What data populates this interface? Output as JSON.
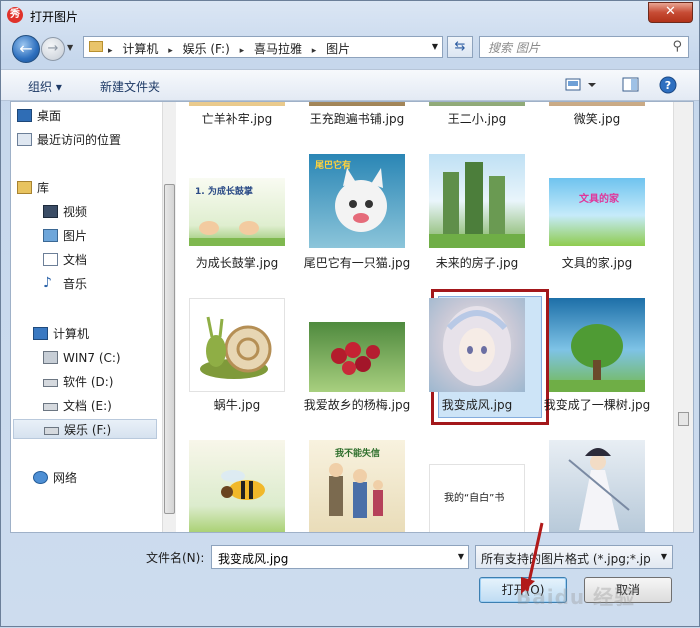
{
  "window": {
    "title": "打开图片",
    "app_icon": "秀",
    "close": "✕"
  },
  "nav": {
    "breadcrumb": [
      "计算机",
      "娱乐 (F:)",
      "喜马拉雅",
      "图片"
    ],
    "search_placeholder": "搜索 图片"
  },
  "toolbar": {
    "organize": "组织 ▾",
    "new_folder": "新建文件夹"
  },
  "sidebar": {
    "items": [
      {
        "label": "桌面",
        "icon": "desktop-icon"
      },
      {
        "label": "最近访问的位置",
        "icon": "recent-places-icon"
      },
      {
        "label": "库",
        "icon": "library-icon"
      },
      {
        "label": "视频",
        "icon": "video-icon"
      },
      {
        "label": "图片",
        "icon": "pictures-icon"
      },
      {
        "label": "文档",
        "icon": "documents-icon"
      },
      {
        "label": "音乐",
        "icon": "music-icon"
      },
      {
        "label": "计算机",
        "icon": "computer-icon"
      },
      {
        "label": "WIN7 (C:)",
        "icon": "drive-c-icon"
      },
      {
        "label": "软件 (D:)",
        "icon": "drive-d-icon"
      },
      {
        "label": "文档 (E:)",
        "icon": "drive-e-icon"
      },
      {
        "label": "娱乐 (F:)",
        "icon": "drive-f-icon"
      },
      {
        "label": "网络",
        "icon": "network-icon"
      }
    ]
  },
  "files": [
    {
      "name": "亡羊补牢.jpg"
    },
    {
      "name": "王充跑遍书铺.jpg"
    },
    {
      "name": "王二小.jpg"
    },
    {
      "name": "微笑.jpg"
    },
    {
      "name": "为成长鼓掌.jpg",
      "thumb_text": "1. 为成长鼓掌"
    },
    {
      "name": "尾巴它有一只猫.jpg",
      "thumb_text": "尾巴它有"
    },
    {
      "name": "未来的房子.jpg"
    },
    {
      "name": "文具的家.jpg",
      "thumb_text": "文具的家"
    },
    {
      "name": "蜗牛.jpg"
    },
    {
      "name": "我爱故乡的杨梅.jpg"
    },
    {
      "name": "我变成风.jpg"
    },
    {
      "name": "我变成了一棵树.jpg"
    },
    {
      "name": "",
      "thumb_text": ""
    },
    {
      "name": "",
      "thumb_text": "我不能失信"
    },
    {
      "name": "",
      "thumb_text": "我的“自白”书"
    },
    {
      "name": ""
    }
  ],
  "bottom": {
    "filename_label": "文件名(N):",
    "filename_value": "我变成风.jpg",
    "filetype": "所有支持的图片格式 (*.jpg;*.jp",
    "open": "打开(O)",
    "cancel": "取消",
    "watermark": "Baidu 经验"
  },
  "colors": {
    "selection_outline": "#a3171b",
    "arrow": "#b11a1a"
  }
}
